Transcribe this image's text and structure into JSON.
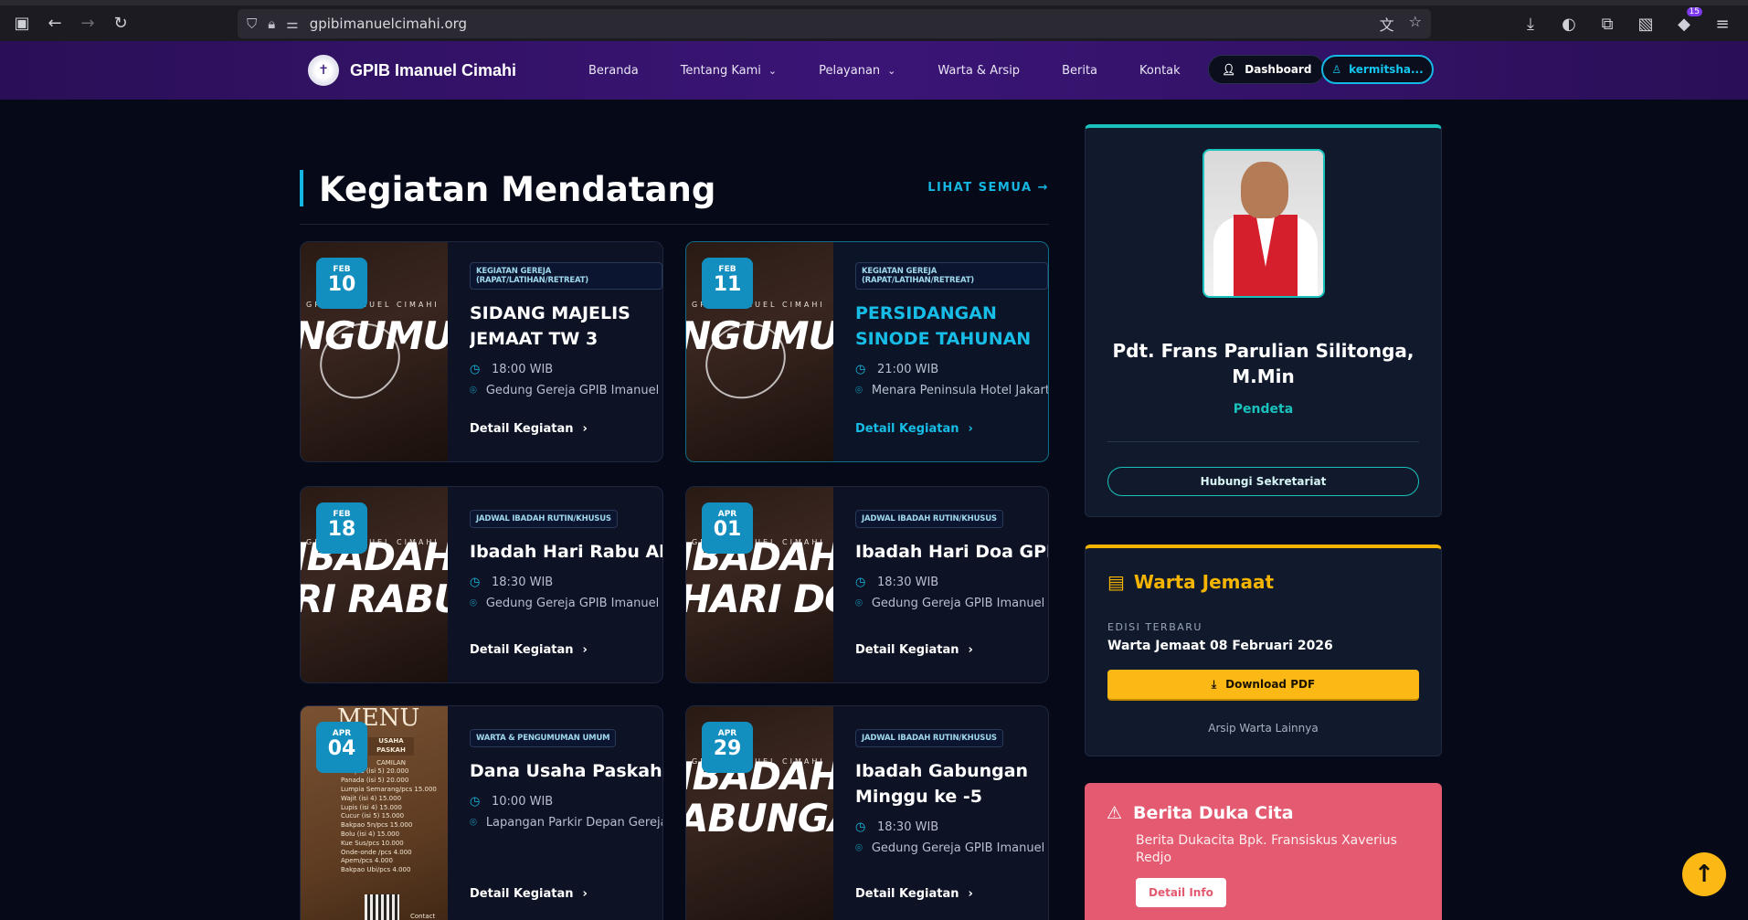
{
  "browser": {
    "url": "gpibimanuelcimahi.org",
    "ext_count": "15"
  },
  "nav": {
    "brand": "GPIB Imanuel Cimahi",
    "items": [
      {
        "label": "Beranda",
        "dropdown": false
      },
      {
        "label": "Tentang Kami",
        "dropdown": true
      },
      {
        "label": "Pelayanan",
        "dropdown": true
      },
      {
        "label": "Warta & Arsip",
        "dropdown": false
      },
      {
        "label": "Berita",
        "dropdown": false
      },
      {
        "label": "Kontak",
        "dropdown": false
      }
    ],
    "dashboard": "Dashboard",
    "user": "kermitsha..."
  },
  "section": {
    "title": "Kegiatan Mendatang",
    "see_all": "LIHAT SEMUA"
  },
  "events": [
    {
      "month": "FEB",
      "day": "10",
      "tag": "KEGIATAN GEREJA (RAPAT/LATIHAN/RETREAT)",
      "title_lines": [
        "SIDANG MAJELIS",
        "JEMAAT TW 3"
      ],
      "time": "18:00 WIB",
      "place": "Gedung Gereja GPIB Imanuel Cimahi",
      "detail": "Detail Kegiatan",
      "thumb_big": [
        "NGUMUM"
      ],
      "thumb_small": "GPIB IMANUEL CIMAHI"
    },
    {
      "month": "FEB",
      "day": "11",
      "tag": "KEGIATAN GEREJA (RAPAT/LATIHAN/RETREAT)",
      "title_lines": [
        "PERSIDANGAN",
        "SINODE TAHUNAN"
      ],
      "time": "21:00 WIB",
      "place": "Menara Peninsula Hotel Jakarta",
      "detail": "Detail Kegiatan",
      "thumb_big": [
        "NGUMUM"
      ],
      "thumb_small": "GPIB IMANUEL CIMAHI"
    },
    {
      "month": "FEB",
      "day": "18",
      "tag": "JADWAL IBADAH RUTIN/KHUSUS",
      "title_lines": [
        "Ibadah Hari Rabu Abu"
      ],
      "time": "18:30 WIB",
      "place": "Gedung Gereja GPIB Imanuel Cimahi",
      "detail": "Detail Kegiatan",
      "thumb_big": [
        "IBADAH",
        "RI RABU A"
      ],
      "thumb_small": "GPIB IMANUEL CIMAHI"
    },
    {
      "month": "APR",
      "day": "01",
      "tag": "JADWAL IBADAH RUTIN/KHUSUS",
      "title_lines": [
        "Ibadah Hari Doa GPIB"
      ],
      "time": "18:30 WIB",
      "place": "Gedung Gereja GPIB Imanuel Cimahi",
      "detail": "Detail Kegiatan",
      "thumb_big": [
        "IBADAH",
        "HARI DOA"
      ],
      "thumb_small": "GPIB IMANUEL CIMAHI"
    },
    {
      "month": "APR",
      "day": "04",
      "tag": "WARTA & PENGUMUMAN UMUM",
      "title_lines": [
        "Dana Usaha Paskah"
      ],
      "time": "10:00 WIB",
      "place": "Lapangan Parkir Depan Gereja",
      "detail": "Detail Kegiatan",
      "thumb_big": [],
      "thumb_small": ""
    },
    {
      "month": "APR",
      "day": "29",
      "tag": "JADWAL IBADAH RUTIN/KHUSUS",
      "title_lines": [
        "Ibadah Gabungan",
        "Minggu ke -5"
      ],
      "time": "18:30 WIB",
      "place": "Gedung Gereja GPIB Imanuel Cimahi",
      "detail": "Detail Kegiatan",
      "thumb_big": [
        "IBADAH",
        "ABUNGA"
      ],
      "thumb_small": "GPIB IMANUEL CIMAHI"
    }
  ],
  "menu_thumb": {
    "title": "MENU",
    "subtitle": "USAHA PASKAH",
    "heading": "CAMILAN",
    "rows": [
      "Lumpia (isi 5)  20.000",
      "Panada (isi 5)  20.000",
      "Lumpia Semarang/pcs  15.000",
      "Wajit (isi 4)  15.000",
      "Lupis (isi 4)  15.000",
      "Cucur (isi 5)  15.000",
      "Bakpao 5n/pcs  15.000",
      "Bolu (isi 4)  15.000",
      "Kue Sus/pcs  10.000",
      "Onde-onde /pcs  4.000",
      "Apem/pcs  4.000",
      "Bakpao Ubi/pcs  4.000"
    ],
    "contact": "Contact"
  },
  "pastor": {
    "name_lines": [
      "Pdt. Frans Parulian Silitonga,",
      "M.Min"
    ],
    "role": "Pendeta",
    "button": "Hubungi Sekretariat"
  },
  "warta": {
    "title": "Warta Jemaat",
    "edition_label": "EDISI TERBARU",
    "edition": "Warta Jemaat 08 Februari 2026",
    "download": "Download PDF",
    "archive": "Arsip Warta Lainnya"
  },
  "duka": {
    "title": "Berita Duka Cita",
    "text": "Berita Dukacita Bpk. Fransiskus Xaverius Redjo",
    "button": "Detail Info"
  },
  "colors": {
    "accent": "#16b6e2",
    "teal": "#19c2bd",
    "gold": "#fcb814",
    "duka": "#e45a70",
    "nav": "#3b1576"
  }
}
